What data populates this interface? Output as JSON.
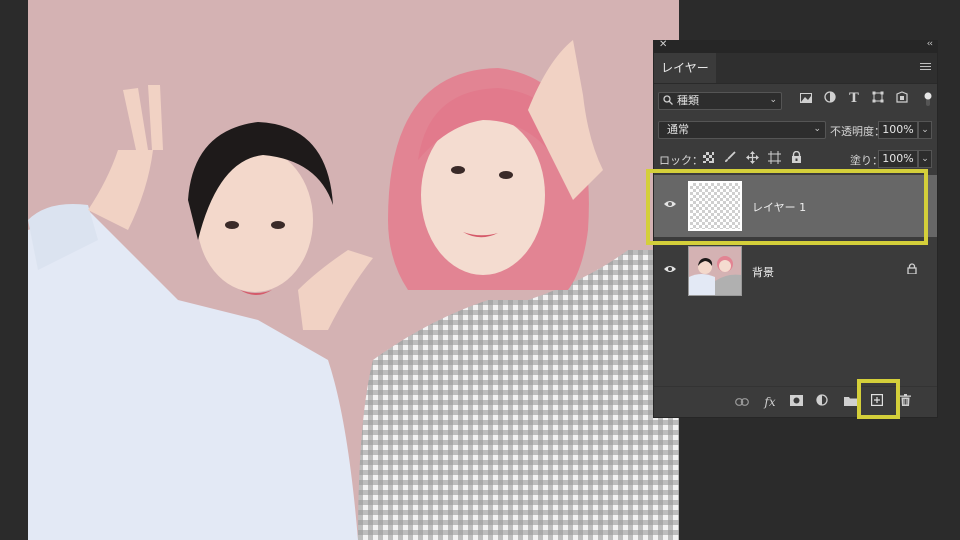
{
  "panel": {
    "close_glyph": "✕",
    "collapse_glyph": "‹‹",
    "tab_label": "レイヤー",
    "filter": {
      "value": "種類",
      "icon": "search-icon"
    },
    "blend": {
      "mode": "通常",
      "opacity_label": "不透明度：",
      "opacity_value": "100%"
    },
    "lock": {
      "label": "ロック：",
      "fill_label": "塗り：",
      "fill_value": "100%"
    },
    "layers": [
      {
        "name": "レイヤー 1",
        "selected": true,
        "thumbnail": "transparent"
      },
      {
        "name": "背景",
        "selected": false,
        "thumbnail": "photo",
        "locked": true
      }
    ]
  },
  "colors": {
    "highlight": "#d4cf3a",
    "photo_background": "#d4b2b3",
    "panel_bg": "#3b3b3b",
    "selected_layer": "#676767"
  }
}
